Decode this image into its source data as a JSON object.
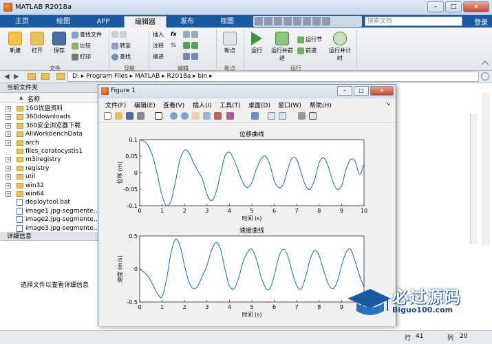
{
  "window": {
    "title": "MATLAB R2018a",
    "min": "–",
    "max": "□",
    "close": "×"
  },
  "tabs": [
    {
      "label": "主页"
    },
    {
      "label": "绘图"
    },
    {
      "label": "APP"
    },
    {
      "label": "编辑器"
    },
    {
      "label": "发布"
    },
    {
      "label": "视图"
    }
  ],
  "search": {
    "placeholder": "搜索文档"
  },
  "login": "登录",
  "ribbon": {
    "new": "新建",
    "open": "打开",
    "save": "保存",
    "find_files": "查找文件",
    "compare": "比较",
    "print": "打印",
    "file_group": "文件",
    "goto": "转至",
    "find": "查找",
    "nav_group": "导航",
    "insert": "插入",
    "comment": "注释",
    "indent": "缩进",
    "fx": "fx",
    "pct": "%",
    "edit_group": "编辑",
    "breakpoints": "断点",
    "bp_group": "断点",
    "run": "运行",
    "run_advance": "运行并前进",
    "run_section": "运行节",
    "advance": "前进",
    "run_time": "运行并计时",
    "run_group": "运行"
  },
  "address": {
    "path": "D: ▸ Program Files ▸ MATLAB ▸ R2018a ▸ bin ▸"
  },
  "left_panel": {
    "current_folder": "当前文件夹",
    "name_col": "名称",
    "details": "详细信息",
    "details_msg": "选择文件以查看详细信息"
  },
  "files": [
    {
      "name": "16G优盘资料",
      "type": "folder",
      "exp": "+"
    },
    {
      "name": "360downloads",
      "type": "folder",
      "exp": "+"
    },
    {
      "name": "360安全浏览器下载",
      "type": "folder",
      "exp": "+"
    },
    {
      "name": "AliWorkbenchData",
      "type": "folder",
      "exp": "+"
    },
    {
      "name": "arch",
      "type": "folder",
      "exp": "+"
    },
    {
      "name": "files_ceratocystis1",
      "type": "folder",
      "exp": ""
    },
    {
      "name": "m3iregistry",
      "type": "folder",
      "exp": "+"
    },
    {
      "name": "registry",
      "type": "folder",
      "exp": "+"
    },
    {
      "name": "util",
      "type": "folder",
      "exp": "+"
    },
    {
      "name": "win32",
      "type": "folder",
      "exp": "+"
    },
    {
      "name": "win64",
      "type": "folder",
      "exp": "+"
    },
    {
      "name": "deploytool.bat",
      "type": "file",
      "exp": ""
    },
    {
      "name": "image1.jpg-segmente...",
      "type": "file",
      "exp": ""
    },
    {
      "name": "image2.jpg-segmente...",
      "type": "file",
      "exp": ""
    },
    {
      "name": "image3.jpg-segmente...",
      "type": "file",
      "exp": ""
    }
  ],
  "status": {
    "col_label": "行",
    "ln": "41",
    "col_label2": "列",
    "col": "20"
  },
  "figure": {
    "title": "Figure 1",
    "menu": [
      "文件(F)",
      "编辑(E)",
      "查看(V)",
      "插入(I)",
      "工具(T)",
      "桌面(D)",
      "窗口(W)",
      "帮助(H)"
    ]
  },
  "watermark": {
    "text": "必过源码",
    "url": "Biguo100.com"
  },
  "chart_data": [
    {
      "type": "line",
      "title": "位移曲线",
      "xlabel": "时间 (s)",
      "ylabel": "位移 (m)",
      "xlim": [
        0,
        10
      ],
      "ylim": [
        -0.1,
        0.1
      ],
      "xticks": [
        0,
        1,
        2,
        3,
        4,
        5,
        6,
        7,
        8,
        9,
        10
      ],
      "yticks": [
        -0.1,
        -0.05,
        0,
        0.05,
        0.1
      ],
      "x": [
        0,
        0.2,
        0.4,
        0.6,
        0.8,
        1.0,
        1.2,
        1.4,
        1.6,
        1.8,
        2.0,
        2.2,
        2.4,
        2.6,
        2.8,
        3.0,
        3.2,
        3.4,
        3.6,
        3.8,
        4.0,
        4.2,
        4.4,
        4.6,
        4.8,
        5.0,
        5.2,
        5.4,
        5.6,
        5.8,
        6.0,
        6.2,
        6.4,
        6.6,
        6.8,
        7.0,
        7.2,
        7.4,
        7.6,
        7.8,
        8.0,
        8.2,
        8.4,
        8.6,
        8.8,
        9.0,
        9.2,
        9.4,
        9.6,
        9.8,
        10.0
      ],
      "series": [
        {
          "values": [
            0.1,
            0.095,
            0.08,
            0.045,
            -0.01,
            -0.07,
            -0.1,
            -0.085,
            -0.025,
            0.04,
            0.068,
            0.06,
            0.03,
            0.005,
            -0.02,
            -0.065,
            -0.085,
            -0.06,
            -0.005,
            0.05,
            0.062,
            0.04,
            0.005,
            -0.03,
            -0.045,
            -0.03,
            0.01,
            0.04,
            0.05,
            0.025,
            -0.025,
            -0.045,
            -0.035,
            0.01,
            0.045,
            0.04,
            0.0,
            -0.04,
            -0.05,
            -0.02,
            0.03,
            0.045,
            0.02,
            -0.025,
            -0.05,
            -0.04,
            0.01,
            0.04,
            0.035,
            -0.005,
            0.025
          ]
        }
      ]
    },
    {
      "type": "line",
      "title": "速度曲线",
      "xlabel": "时间 (s)",
      "ylabel": "速度 (m/s)",
      "xlim": [
        0,
        10
      ],
      "ylim": [
        -0.5,
        0.5
      ],
      "xticks": [
        0,
        1,
        2,
        3,
        4,
        5,
        6,
        7,
        8,
        9,
        10
      ],
      "yticks": [
        -0.5,
        0,
        0.5
      ],
      "x": [
        0,
        0.2,
        0.4,
        0.6,
        0.8,
        1.0,
        1.2,
        1.4,
        1.6,
        1.8,
        2.0,
        2.2,
        2.4,
        2.6,
        2.8,
        3.0,
        3.2,
        3.4,
        3.6,
        3.8,
        4.0,
        4.2,
        4.4,
        4.6,
        4.8,
        5.0,
        5.2,
        5.4,
        5.6,
        5.8,
        6.0,
        6.2,
        6.4,
        6.6,
        6.8,
        7.0,
        7.2,
        7.4,
        7.6,
        7.8,
        8.0,
        8.2,
        8.4,
        8.6,
        8.8,
        9.0,
        9.2,
        9.4,
        9.6,
        9.8,
        10.0
      ],
      "series": [
        {
          "values": [
            0.0,
            -0.05,
            -0.12,
            -0.25,
            -0.38,
            -0.42,
            -0.15,
            0.25,
            0.45,
            0.35,
            0.05,
            -0.2,
            -0.3,
            -0.25,
            -0.1,
            0.05,
            0.28,
            0.4,
            0.3,
            0.0,
            -0.25,
            -0.3,
            -0.15,
            0.1,
            0.25,
            0.3,
            0.15,
            -0.1,
            -0.28,
            -0.3,
            -0.1,
            0.18,
            0.3,
            0.2,
            -0.05,
            -0.25,
            -0.3,
            -0.12,
            0.15,
            0.28,
            0.2,
            -0.02,
            -0.22,
            -0.3,
            -0.2,
            0.05,
            0.25,
            0.3,
            0.12,
            -0.1,
            -0.28
          ]
        }
      ]
    }
  ]
}
